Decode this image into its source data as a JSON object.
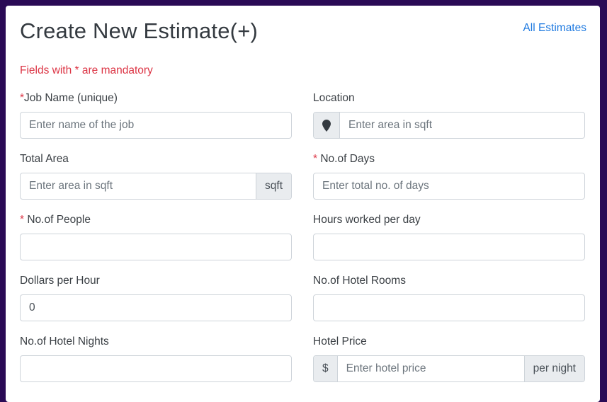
{
  "header": {
    "title": "Create New Estimate(+)",
    "all_estimates_link": "All Estimates",
    "mandatory_note": "Fields with * are mandatory"
  },
  "form": {
    "job_name": {
      "required_mark": "*",
      "label": "Job Name (unique)",
      "placeholder": "Enter name of the job",
      "value": ""
    },
    "location": {
      "label": "Location",
      "icon": "map-marker-icon",
      "placeholder": "Enter area in sqft",
      "value": ""
    },
    "total_area": {
      "label": "Total Area",
      "placeholder": "Enter area in sqft",
      "value": "",
      "suffix": "sqft"
    },
    "days": {
      "required_mark": "* ",
      "label": "No.of Days",
      "placeholder": "Enter total no. of days",
      "value": ""
    },
    "people": {
      "required_mark": "* ",
      "label": "No.of People",
      "placeholder": "",
      "value": ""
    },
    "hours_per_day": {
      "label": "Hours worked per day",
      "placeholder": "",
      "value": ""
    },
    "dollars_per_hour": {
      "label": "Dollars per Hour",
      "placeholder": "",
      "value": "0"
    },
    "hotel_rooms": {
      "label": "No.of Hotel Rooms",
      "placeholder": "",
      "value": ""
    },
    "hotel_nights": {
      "label": "No.of Hotel Nights",
      "placeholder": "",
      "value": ""
    },
    "hotel_price": {
      "label": "Hotel Price",
      "prefix": "$",
      "placeholder": "Enter hotel price",
      "value": "",
      "suffix": "per night"
    }
  },
  "colors": {
    "page_background": "#2a0a55",
    "link": "#1f7ae0",
    "required": "#dc3545"
  }
}
